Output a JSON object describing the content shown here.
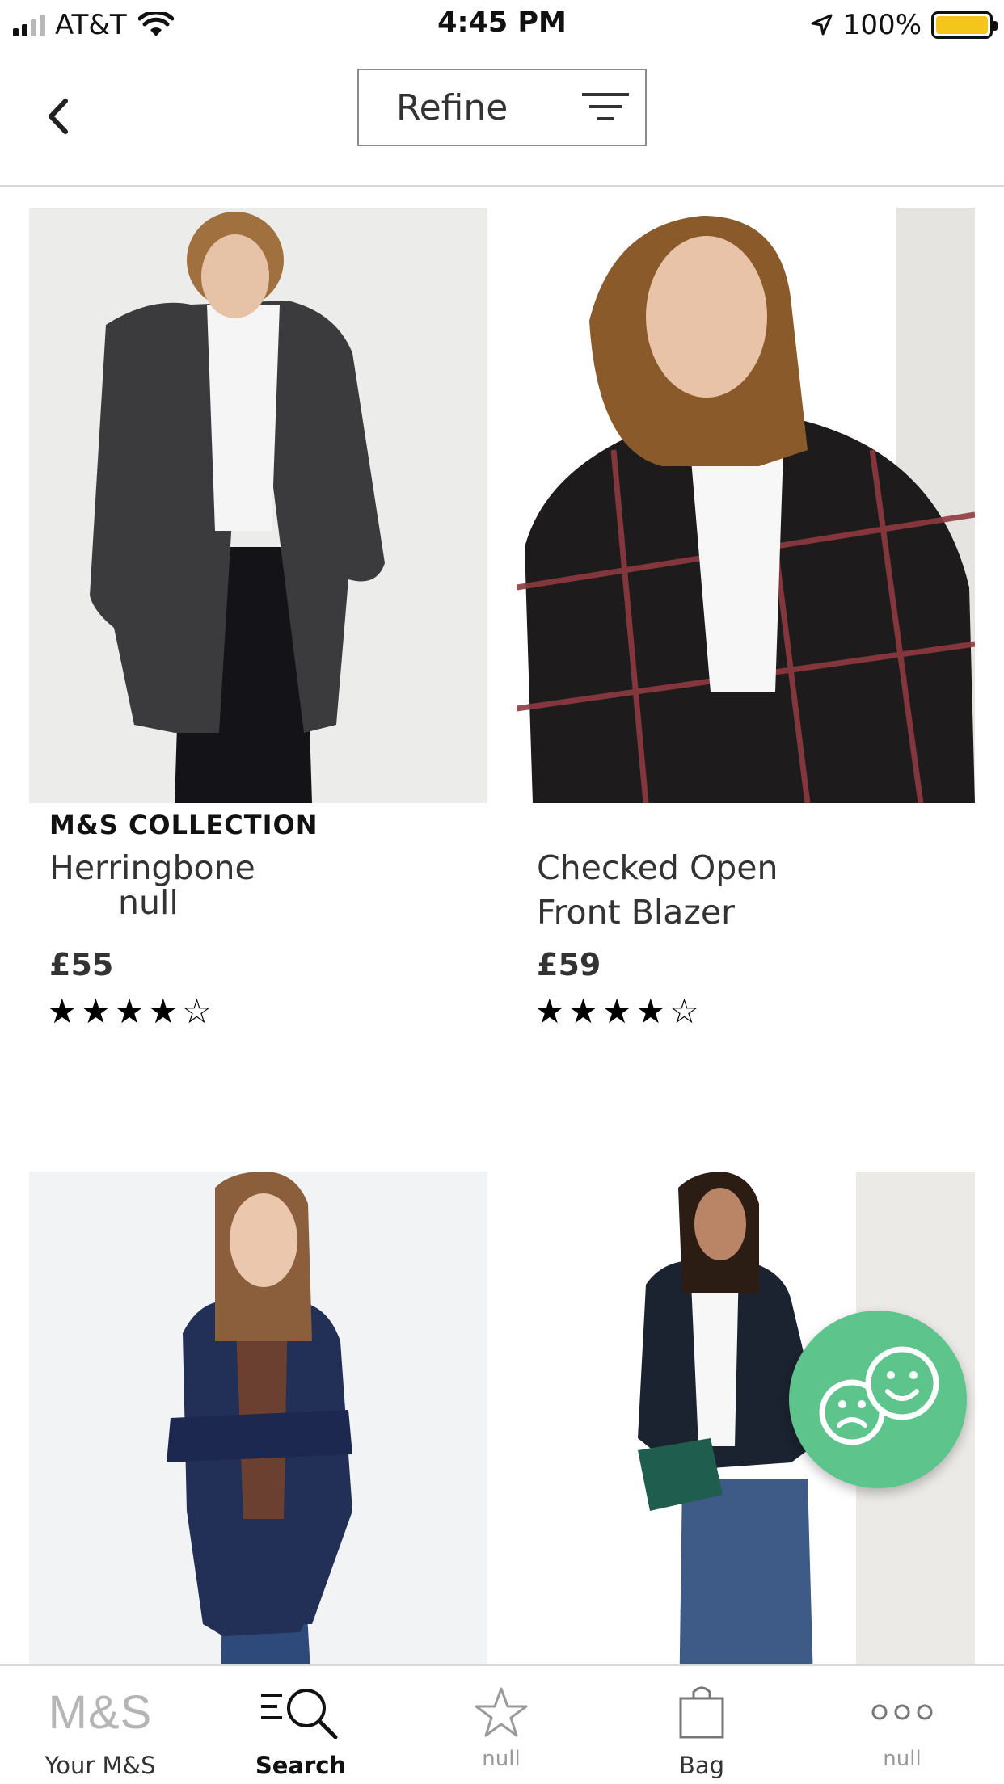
{
  "status_bar": {
    "carrier": "AT&T",
    "time": "4:45 PM",
    "battery_percent": "100%",
    "battery_level": 1.0,
    "battery_color": "#f4c51a"
  },
  "header": {
    "back_icon": "chevron-left-icon",
    "refine_label": "Refine",
    "filter_icon": "filter-lines-icon"
  },
  "products": [
    {
      "brand": "M&S COLLECTION",
      "name_line1": "Herringbone",
      "name_line2": "null",
      "price": "£55",
      "rating_stars": "★★★★☆",
      "rating": 4
    },
    {
      "brand": "",
      "name_line1": "Checked Open",
      "name_line2": "Front Blazer",
      "price": "£59",
      "rating_stars": "★★★★☆",
      "rating": 3.5
    },
    {
      "brand": "",
      "name_line1": "",
      "name_line2": "",
      "price": ""
    },
    {
      "brand": "",
      "name_line1": "",
      "name_line2": "",
      "price": ""
    }
  ],
  "feedback": {
    "icon": "feedback-faces-icon",
    "color": "#5dc48c"
  },
  "tabbar": {
    "tabs": [
      {
        "label": "Your M&S",
        "logo_text": "M&S",
        "icon": "ms-logo-icon"
      },
      {
        "label": "Search",
        "icon": "search-icon",
        "active": true
      },
      {
        "label": "null",
        "icon": "star-icon"
      },
      {
        "label": "Bag",
        "icon": "bag-icon"
      },
      {
        "label": "null",
        "icon": "more-icon"
      }
    ]
  }
}
